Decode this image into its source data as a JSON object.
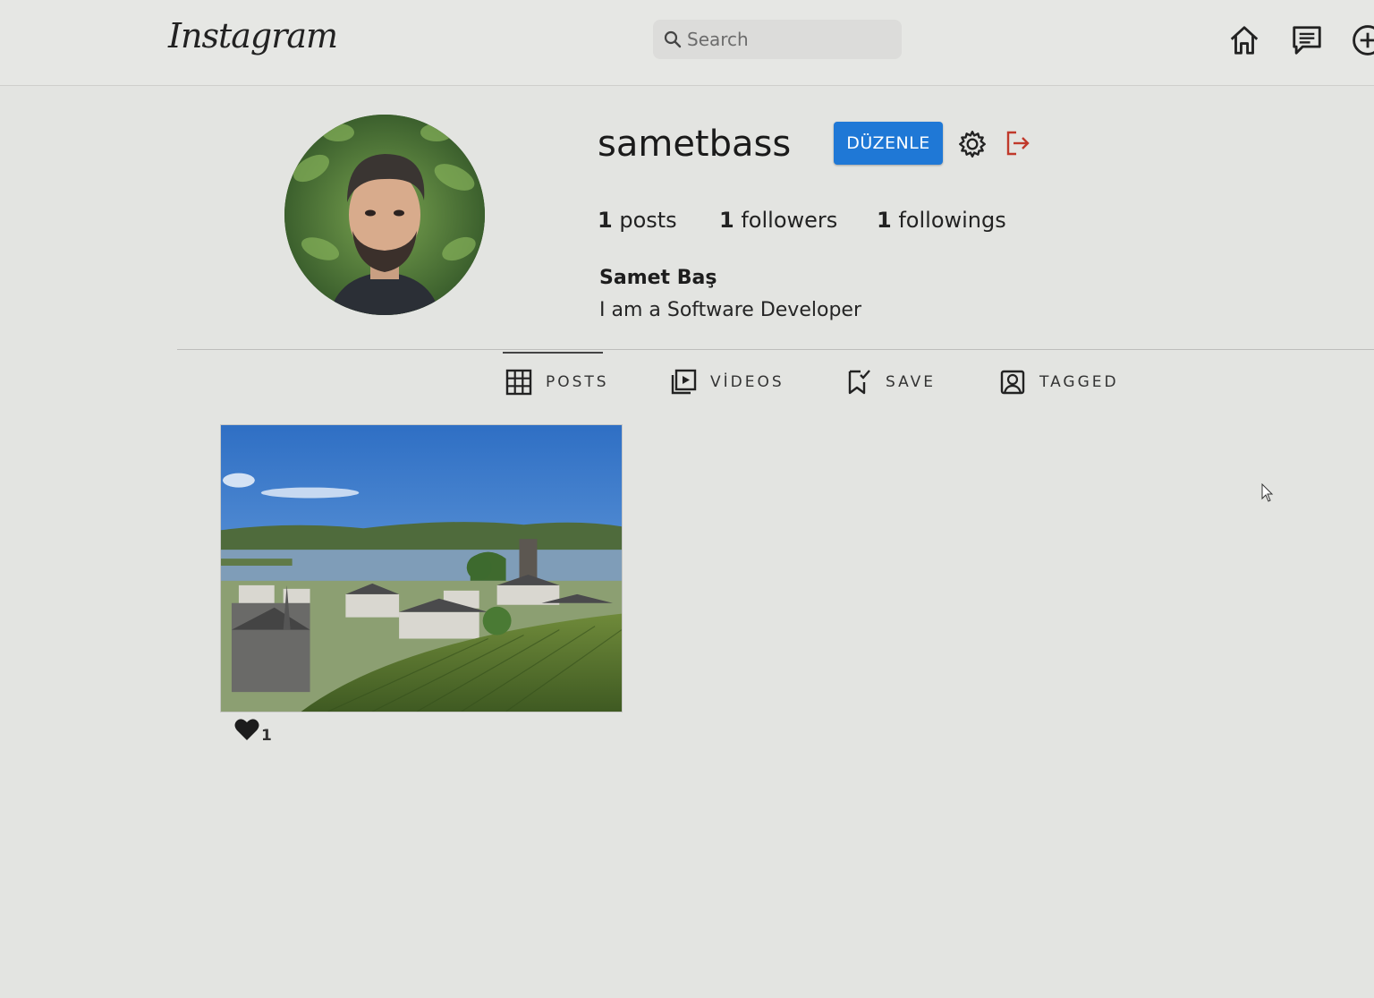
{
  "header": {
    "logo": "Instagram",
    "search_placeholder": "Search"
  },
  "profile": {
    "username": "sametbass",
    "edit_label": "DÜZENLE",
    "stats": {
      "posts_count": "1",
      "posts_label": "posts",
      "followers_count": "1",
      "followers_label": "followers",
      "followings_count": "1",
      "followings_label": "followings"
    },
    "full_name": "Samet Baş",
    "bio": "I am a Software Developer"
  },
  "tabs": [
    {
      "label": "POSTS",
      "icon": "grid-icon",
      "active": true
    },
    {
      "label": "VİDEOS",
      "icon": "video-icon",
      "active": false
    },
    {
      "label": "SAVE",
      "icon": "bookmark-icon",
      "active": false
    },
    {
      "label": "TAGGED",
      "icon": "tagged-icon",
      "active": false
    }
  ],
  "posts": [
    {
      "likes": "1"
    }
  ],
  "colors": {
    "accent": "#1f78d6",
    "logout": "#c0392b",
    "background": "#e3e4e1"
  }
}
